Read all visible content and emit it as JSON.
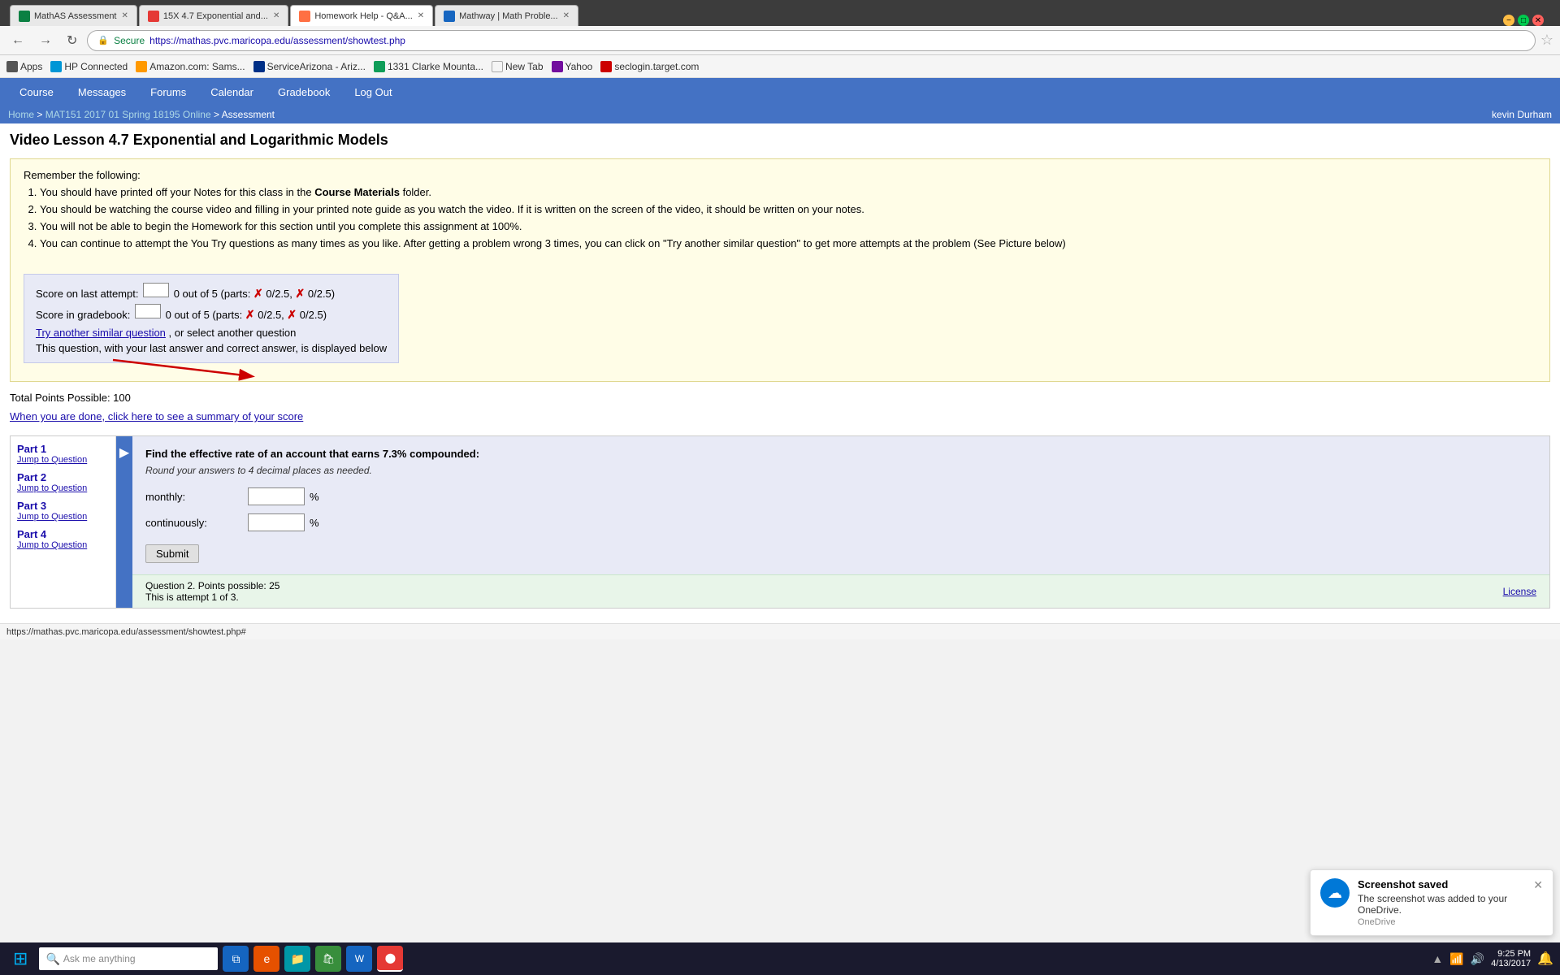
{
  "browser": {
    "tabs": [
      {
        "id": "tab1",
        "label": "MathAS Assessment",
        "favicon_color": "green",
        "active": false
      },
      {
        "id": "tab2",
        "label": "15X 4.7 Exponential and...",
        "favicon_color": "red",
        "active": false
      },
      {
        "id": "tab3",
        "label": "Homework Help - Q&A...",
        "favicon_color": "orange",
        "active": true
      },
      {
        "id": "tab4",
        "label": "Mathway | Math Proble...",
        "favicon_color": "blue",
        "active": false
      }
    ],
    "address_bar": {
      "secure_label": "Secure",
      "url": "https://mathas.pvc.maricopa.edu/assessment/showtest.php"
    },
    "bookmarks": [
      {
        "label": "Apps",
        "type": "apps"
      },
      {
        "label": "HP Connected",
        "type": "hp"
      },
      {
        "label": "Amazon.com: Sams...",
        "type": "amazon"
      },
      {
        "label": "ServiceArizona - Ariz...",
        "type": "service"
      },
      {
        "label": "1331 Clarke Mounta...",
        "type": "1331"
      },
      {
        "label": "New Tab",
        "type": "newtab"
      },
      {
        "label": "Yahoo",
        "type": "yahoo"
      },
      {
        "label": "seclogin.target.com",
        "type": "sec"
      }
    ]
  },
  "site_nav": {
    "items": [
      "Course",
      "Messages",
      "Forums",
      "Calendar",
      "Gradebook",
      "Log Out"
    ]
  },
  "breadcrumb": {
    "parts": [
      "Home",
      "MAT151 2017 01 Spring 18195 Online",
      "Assessment"
    ],
    "user": "kevin Durham"
  },
  "page": {
    "title": "Video Lesson 4.7 Exponential and Logarithmic Models",
    "instructions_header": "Remember the following:",
    "instructions": [
      "You should have printed off your Notes for this class in the Course Materials folder.",
      "You should be watching the course video and filling in your printed note guide as you watch the video.  If it is written on the screen of the video, it should be written on your notes.",
      "You will not be able to begin the Homework for this section until you complete this assignment at 100%.",
      "You can continue to attempt the You Try questions as many times as you like. After getting a problem wrong 3 times, you can click on \"Try another similar question\" to get more attempts at the problem (See Picture below)"
    ],
    "course_materials": "Course Materials",
    "score_last": "Score on last attempt:",
    "score_last_value": "0 out of 5 (parts:",
    "score_gradebook": "Score in gradebook:",
    "score_gradebook_value": "0 out of 5 (parts:",
    "parts_score_1": "0/2.5,",
    "parts_score_2": "0/2.5)",
    "parts_score_3": "0/2.5,",
    "parts_score_4": "0/2.5)",
    "try_link": "Try another similar question",
    "or_select": ", or select another question",
    "last_answer_note": "This question, with your last answer and correct answer, is displayed below",
    "total_points": "Total Points Possible: 100",
    "summary_link": "When you are done, click here to see a summary of your score"
  },
  "parts_nav": {
    "parts": [
      {
        "label": "Part 1",
        "jump": "Jump to Question"
      },
      {
        "label": "Part 2",
        "jump": "Jump to Question"
      },
      {
        "label": "Part 3",
        "jump": "Jump to Question"
      },
      {
        "label": "Part 4",
        "jump": "Jump to Question"
      }
    ]
  },
  "question": {
    "text": "Find the effective rate of an account that earns 7.3% compounded:",
    "sub": "Round your answers to 4 decimal places as needed.",
    "fields": [
      {
        "label": "monthly:",
        "name": "monthly",
        "placeholder": ""
      },
      {
        "label": "continuously:",
        "name": "continuously",
        "placeholder": ""
      }
    ],
    "percent_symbol": "%",
    "submit_label": "Submit",
    "footer": {
      "points": "Question 2. Points possible: 25",
      "attempt": "This is attempt 1 of 3.",
      "license": "License"
    }
  },
  "toast": {
    "title": "Screenshot saved",
    "body": "The screenshot was added to your OneDrive.",
    "source": "OneDrive"
  },
  "taskbar": {
    "time": "9:25 PM",
    "date": "4/13/2017",
    "search_placeholder": "Ask me anything"
  },
  "status_bar": {
    "url": "https://mathas.pvc.maricopa.edu/assessment/showtest.php#"
  }
}
